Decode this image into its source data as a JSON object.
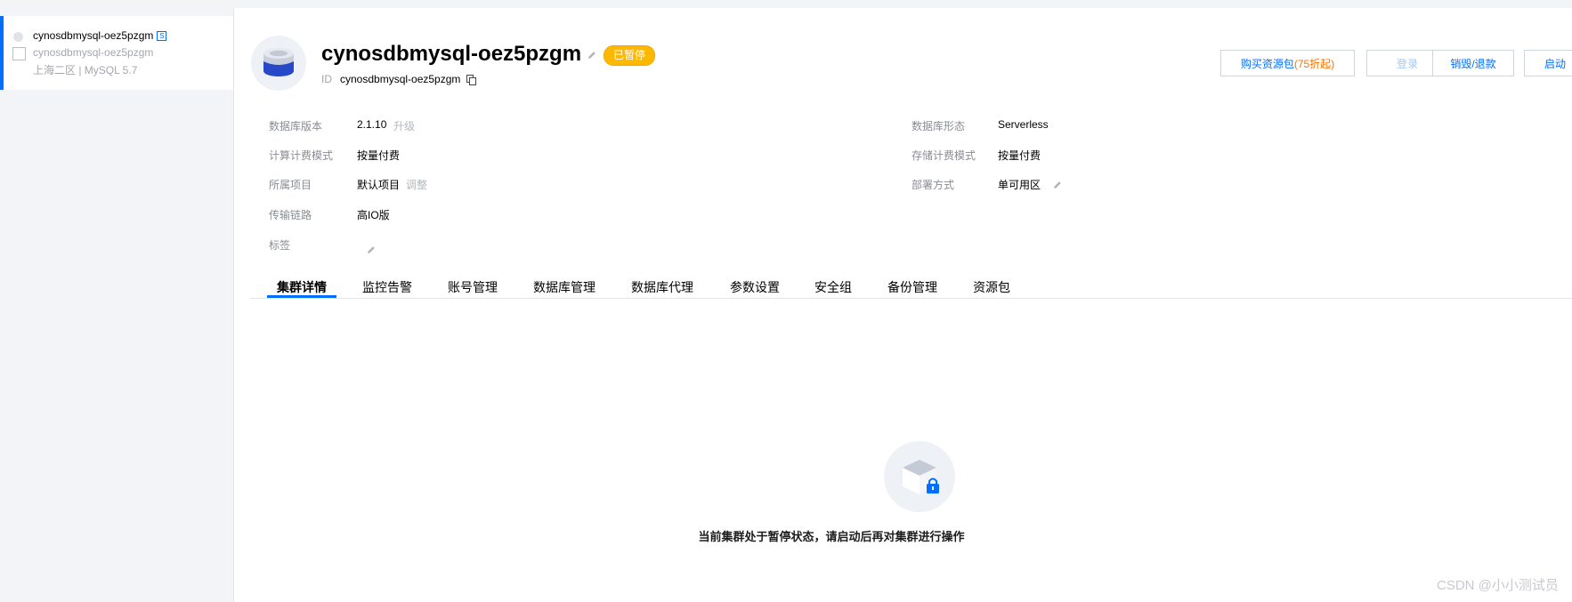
{
  "sidebar": {
    "instance_name": "cynosdbmysql-oez5pzgm",
    "instance_badge": "S",
    "instance_subname": "cynosdbmysql-oez5pzgm",
    "instance_meta": "上海二区 | MySQL 5.7"
  },
  "header": {
    "title": "cynosdbmysql-oez5pzgm",
    "status": "已暂停",
    "id_label": "ID",
    "id_value": "cynosdbmysql-oez5pzgm",
    "buttons": {
      "buy": "购买资源包",
      "buy_promo": "(75折起)",
      "login": "登录",
      "destroy": "销毁/退款",
      "start": "启动"
    }
  },
  "info": {
    "db_version_label": "数据库版本",
    "db_version_value": "2.1.10",
    "db_version_link": "升级",
    "db_form_label": "数据库形态",
    "db_form_value": "Serverless",
    "compute_billing_label": "计算计费模式",
    "compute_billing_value": "按量付费",
    "storage_billing_label": "存储计费模式",
    "storage_billing_value": "按量付费",
    "project_label": "所属项目",
    "project_value": "默认项目",
    "project_link": "调整",
    "deploy_label": "部署方式",
    "deploy_value": "单可用区",
    "transport_label": "传输链路",
    "transport_value": "高IO版",
    "tags_label": "标签"
  },
  "tabs": [
    "集群详情",
    "监控告警",
    "账号管理",
    "数据库管理",
    "数据库代理",
    "参数设置",
    "安全组",
    "备份管理",
    "资源包"
  ],
  "empty_state": {
    "message": "当前集群处于暂停状态，请启动后再对集群进行操作"
  },
  "watermark": "CSDN @小小测试员",
  "colors": {
    "accent": "#006eff",
    "badge": "#ffb800",
    "promo": "#ff7200"
  }
}
